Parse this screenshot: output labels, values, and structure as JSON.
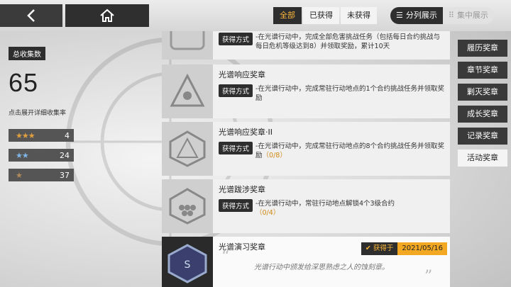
{
  "header": {
    "filters": [
      "全部",
      "已获得",
      "未获得"
    ],
    "active_filter": 0,
    "view_modes": {
      "split": "分列展示",
      "focus": "集中展示"
    }
  },
  "summary": {
    "total_label": "总收集数",
    "total": "65",
    "hint": "点击展开详细收集率",
    "ranks": [
      {
        "stars": "★★★",
        "count": "4"
      },
      {
        "stars": "★★",
        "count": "24"
      },
      {
        "stars": "★",
        "count": "37"
      }
    ]
  },
  "medals": [
    {
      "title": "",
      "tag": "获得方式",
      "desc": "-在光谱行动中，完成全部危害挑战任务（包括每日合约挑战与每日危机等级达到8）并领取奖励，累计10天",
      "progress": ""
    },
    {
      "title": "光谱响应奖章",
      "tag": "获得方式",
      "desc": "-在光谱行动中，完成常驻行动地点的1个合约挑战任务并领取奖励",
      "progress": ""
    },
    {
      "title": "光谱响应奖章·II",
      "tag": "获得方式",
      "desc": "-在光谱行动中，完成常驻行动地点的8个合约挑战任务并领取奖励",
      "progress": "（0/8）"
    },
    {
      "title": "光谱跋涉奖章",
      "tag": "获得方式",
      "desc": "-在光谱行动中，常驻行动地点解锁4个3级合约",
      "progress": "（0/4）"
    }
  ],
  "featured": {
    "title": "光谱演习奖章",
    "obtained_label": "获得于",
    "date": "2021/05/16",
    "quote": "光谱行动中颁发给深思熟虑之人的蚀刻章。"
  },
  "side_tabs": [
    "履历奖章",
    "章节奖章",
    "剿灭奖章",
    "成长奖章",
    "记录奖章",
    "活动奖章"
  ],
  "active_side_tab": 5,
  "colors": {
    "accent": "#f3a823",
    "dark": "#2e2e2e",
    "star_gold": "#e0a040",
    "star_blue": "#7fb5e8",
    "star_bronze": "#b38a5a"
  }
}
